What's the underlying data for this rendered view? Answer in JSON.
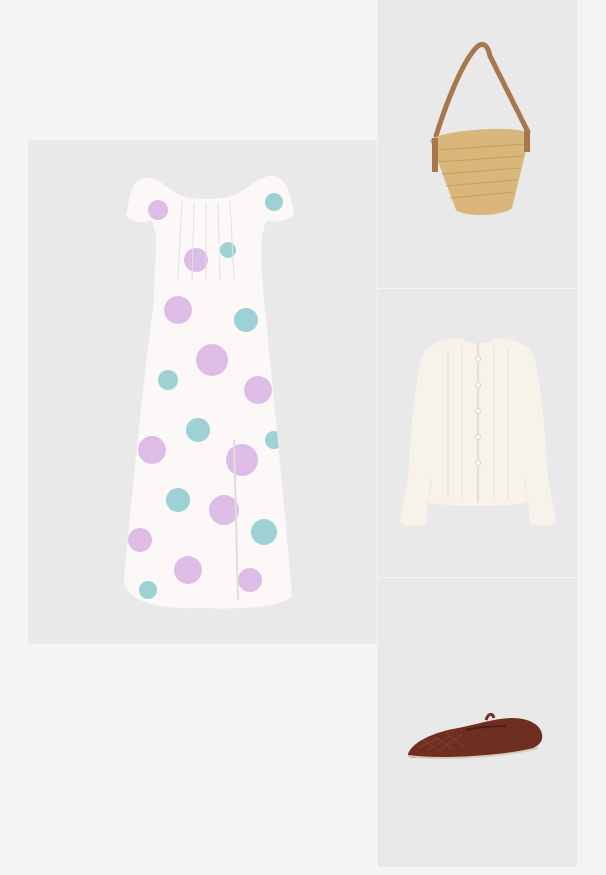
{
  "board": {
    "background": "#f4f4f4",
    "panel_background": "#e9e9e9",
    "items": [
      {
        "name": "floral-midi-dress",
        "colors": {
          "base": "#fbf8f7",
          "accent_lilac": "#d3a9e0",
          "accent_teal": "#7fc4c9"
        }
      },
      {
        "name": "straw-bucket-bag",
        "colors": {
          "straw": "#d9b77a",
          "strap": "#a6784c"
        }
      },
      {
        "name": "white-knit-cardigan",
        "colors": {
          "knit": "#f7f2ea"
        }
      },
      {
        "name": "brown-woven-mary-jane-flat",
        "colors": {
          "leather": "#6e2f21"
        }
      }
    ]
  }
}
